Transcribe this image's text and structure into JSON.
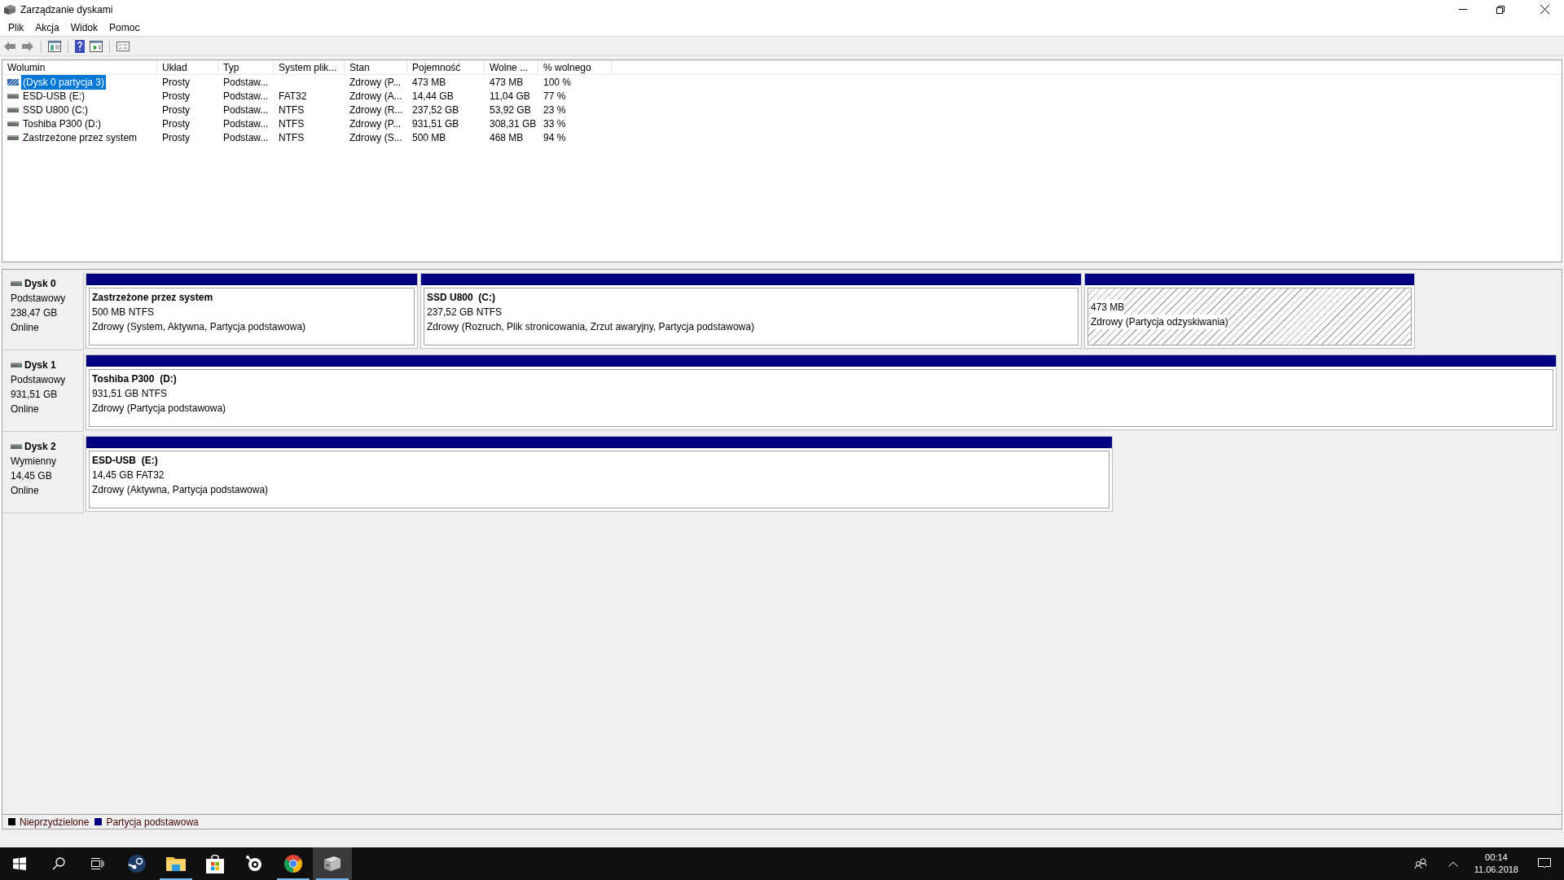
{
  "window": {
    "title": "Zarządzanie dyskami"
  },
  "menu": [
    "Plik",
    "Akcja",
    "Widok",
    "Pomoc"
  ],
  "toolbar": [
    {
      "kind": "back"
    },
    {
      "kind": "forward"
    },
    {
      "kind": "tree"
    },
    {
      "kind": "help"
    },
    {
      "kind": "panel"
    },
    {
      "kind": "list"
    }
  ],
  "table": {
    "columns": [
      "Wolumin",
      "Układ",
      "Typ",
      "System plik...",
      "Stan",
      "Pojemność",
      "Wolne ...",
      "% wolnego"
    ],
    "rows": [
      {
        "selected": true,
        "kind": "recovery",
        "cells": [
          "(Dysk 0 partycja 3)",
          "Prosty",
          "Podstaw...",
          "",
          "Zdrowy (P...",
          "473 MB",
          "473 MB",
          "100 %"
        ]
      },
      {
        "selected": false,
        "kind": "volume",
        "cells": [
          "ESD-USB (E:)",
          "Prosty",
          "Podstaw...",
          "FAT32",
          "Zdrowy (A...",
          "14,44 GB",
          "11,04 GB",
          "77 %"
        ]
      },
      {
        "selected": false,
        "kind": "volume",
        "cells": [
          "SSD U800 (C:)",
          "Prosty",
          "Podstaw...",
          "NTFS",
          "Zdrowy (R...",
          "237,52 GB",
          "53,92 GB",
          "23 %"
        ]
      },
      {
        "selected": false,
        "kind": "volume",
        "cells": [
          "Toshiba P300 (D:)",
          "Prosty",
          "Podstaw...",
          "NTFS",
          "Zdrowy (P...",
          "931,51 GB",
          "308,31 GB",
          "33 %"
        ]
      },
      {
        "selected": false,
        "kind": "volume",
        "cells": [
          "Zastrzeżone przez system",
          "Prosty",
          "Podstaw...",
          "NTFS",
          "Zdrowy (S...",
          "500 MB",
          "468 MB",
          "94 %"
        ]
      }
    ]
  },
  "disks": [
    {
      "name": "Dysk 0",
      "type": "Podstawowy",
      "size": "238,47 GB",
      "status": "Online",
      "partitions": [
        {
          "kind": "primary",
          "name": "Zastrzeżone przez system",
          "size": "500 MB NTFS",
          "status": "Zdrowy (System, Aktywna, Partycja podstawowa)"
        },
        {
          "kind": "primary",
          "name": "SSD U800  (C:)",
          "size": "237,52 GB NTFS",
          "status": "Zdrowy (Rozruch, Plik stronicowania, Zrzut awaryjny, Partycja podstawowa)"
        },
        {
          "kind": "recovery",
          "size": "473 MB",
          "status": "Zdrowy (Partycja odzyskiwania)"
        }
      ]
    },
    {
      "name": "Dysk 1",
      "type": "Podstawowy",
      "size": "931,51 GB",
      "status": "Online",
      "partitions": [
        {
          "kind": "primary",
          "name": "Toshiba P300  (D:)",
          "size": "931,51 GB NTFS",
          "status": "Zdrowy (Partycja podstawowa)"
        }
      ]
    },
    {
      "name": "Dysk 2",
      "type": "Wymienny",
      "size": "14,45 GB",
      "status": "Online",
      "partitions": [
        {
          "kind": "primary",
          "name": "ESD-USB  (E:)",
          "size": "14,45 GB FAT32",
          "status": "Zdrowy (Aktywna, Partycja podstawowa)"
        }
      ]
    }
  ],
  "legend": [
    {
      "label": "Nieprzydzielone",
      "color": "#000000"
    },
    {
      "label": "Partycja podstawowa",
      "color": "#000080"
    }
  ],
  "taskbar": {
    "apps": [
      {
        "kind": "steam",
        "running": false,
        "selected": false
      },
      {
        "kind": "explorer",
        "running": true,
        "selected": false
      },
      {
        "kind": "store",
        "running": false,
        "selected": false
      },
      {
        "kind": "steelseries",
        "running": false,
        "selected": false
      },
      {
        "kind": "chrome",
        "running": true,
        "selected": false
      },
      {
        "kind": "diskmgmt",
        "running": true,
        "selected": true
      }
    ],
    "time": "00:14",
    "date": "11.06.2018"
  }
}
